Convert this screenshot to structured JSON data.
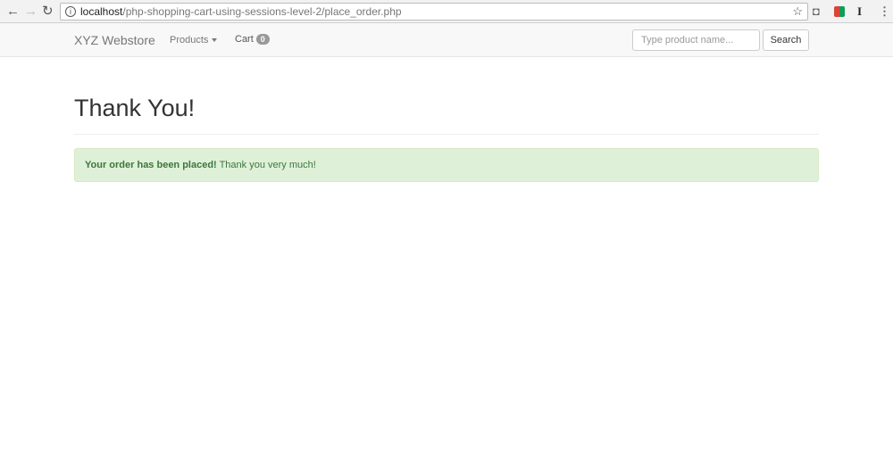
{
  "browser": {
    "url_host": "localhost",
    "url_path": "/php-shopping-cart-using-sessions-level-2/place_order.php"
  },
  "navbar": {
    "brand": "XYZ Webstore",
    "products": "Products",
    "cart": "Cart",
    "cart_count": "0",
    "search_placeholder": "Type product name...",
    "search_button": "Search"
  },
  "main": {
    "title": "Thank You!",
    "alert_strong": "Your order has been placed!",
    "alert_text": " Thank you very much!"
  }
}
